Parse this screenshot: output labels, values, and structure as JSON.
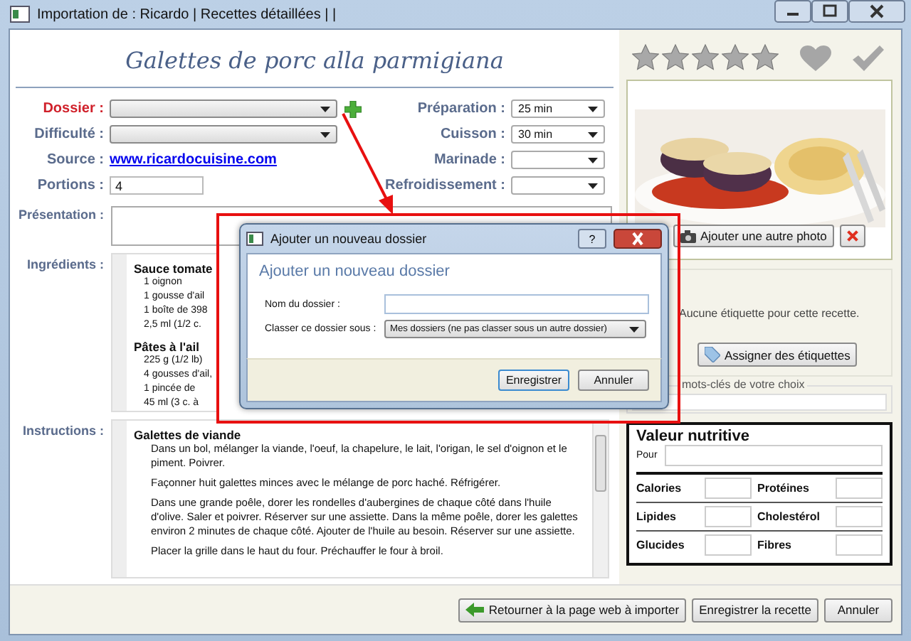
{
  "window": {
    "title": "Importation de : Ricardo | Recettes détaillées | |"
  },
  "recipe_title": "Galettes de porc alla parmigiana",
  "left_fields": [
    {
      "label": "Dossier :",
      "kind": "combo",
      "required": true
    },
    {
      "label": "Difficulté :",
      "kind": "combo",
      "required": false
    },
    {
      "label": "Source :",
      "kind": "link",
      "value": "www.ricardocuisine.com",
      "required": false
    },
    {
      "label": "Portions :",
      "kind": "input",
      "value": "4",
      "required": false
    }
  ],
  "right_fields": [
    {
      "label": "Préparation :",
      "value": "25 min"
    },
    {
      "label": "Cuisson :",
      "value": "30 min"
    },
    {
      "label": "Marinade :"
    },
    {
      "label": "Refroidissement :"
    }
  ],
  "presentation": {
    "label": "Présentation :"
  },
  "ingredients": {
    "label": "Ingrédients :",
    "groups": [
      {
        "title": "Sauce tomate",
        "items": [
          "1 oignon",
          "1 gousse d'ail",
          "1 boîte de 398",
          "2,5 ml (1/2 c."
        ]
      },
      {
        "title": "Pâtes à l'ail",
        "items": [
          "225 g (1/2 lb)",
          "4 gousses d'ail,",
          "1 pincée de",
          "45 ml (3 c. à"
        ]
      }
    ]
  },
  "instructions": {
    "label": "Instructions :",
    "groups": [
      {
        "title": "Galettes de viande",
        "steps": [
          "Dans un bol, mélanger la viande, l'oeuf, la chapelure, le lait, l'origan, le sel d'oignon et le piment. Poivrer.",
          "Façonner huit galettes minces avec le mélange de porc haché. Réfrigérer.",
          "Dans une grande poêle, dorer les rondelles d'aubergines de chaque côté dans l'huile d'olive. Saler et poivrer. Réserver sur une assiette. Dans la même poêle, dorer les galettes environ 2 minutes de chaque côté. Ajouter de l'huile au besoin. Réserver sur une assiette.",
          "Placer la grille dans le haut du four. Préchauffer le four à broil."
        ]
      }
    ]
  },
  "rating": {
    "stars": 0
  },
  "favorite": false,
  "done": false,
  "photo": {
    "kind": "picture",
    "add_button": "Ajouter une autre photo"
  },
  "tags": {
    "empty_text": "Aucune étiquette pour cette recette.",
    "button": "Assigner des étiquettes"
  },
  "keywords": {
    "legend": "mots-clés de votre choix"
  },
  "nutrition": {
    "title": "Valeur nutritive",
    "per_label": "Pour",
    "items": [
      "Calories",
      "Protéines",
      "Lipides",
      "Cholestérol",
      "Glucides",
      "Fibres"
    ]
  },
  "footer_buttons": [
    "Retourner à la page web à importer",
    "Enregistrer la recette",
    "Annuler"
  ],
  "dialog": {
    "title": "Ajouter un nouveau dossier",
    "heading": "Ajouter un nouveau dossier",
    "help": "?",
    "fields": [
      {
        "label": "Nom du dossier :",
        "kind": "input"
      },
      {
        "label": "Classer ce dossier sous :",
        "kind": "combo",
        "value": "Mes dossiers (ne pas classer sous un autre dossier)"
      }
    ],
    "buttons": [
      "Enregistrer",
      "Annuler"
    ]
  }
}
